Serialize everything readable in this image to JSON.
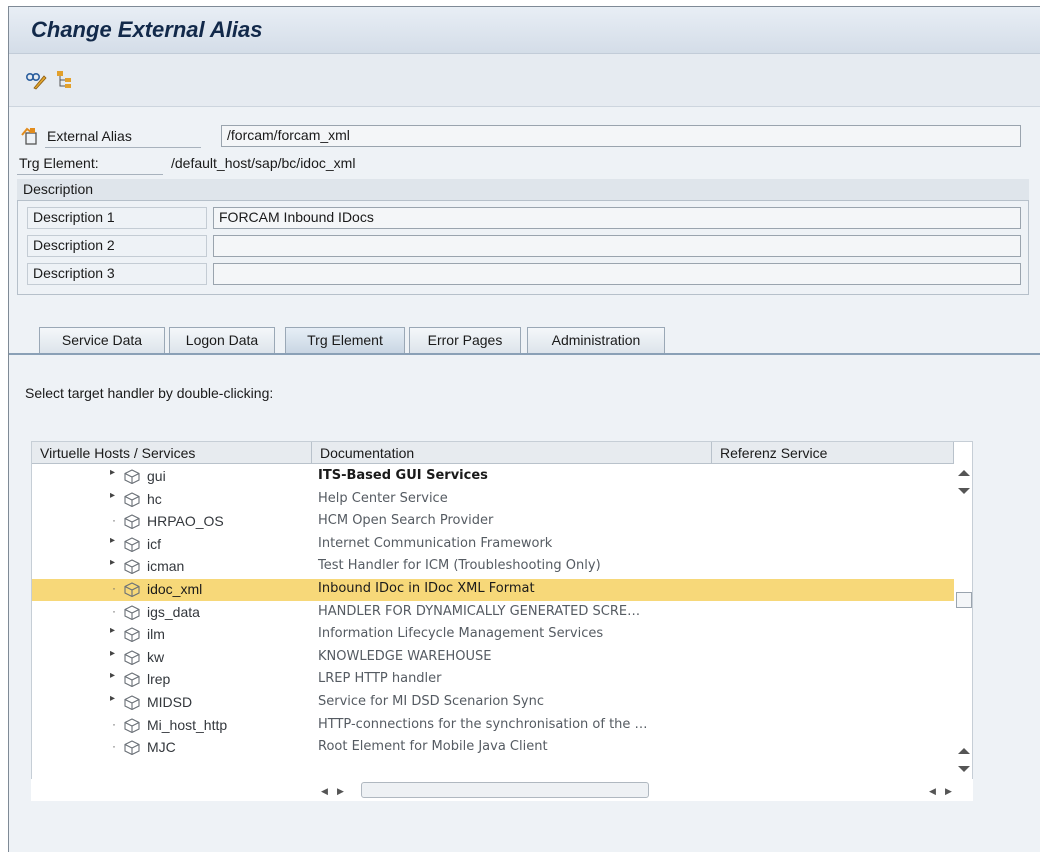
{
  "window": {
    "title": "Change External Alias"
  },
  "toolbar": {
    "icons": [
      "display-change-icon",
      "hierarchy-icon"
    ]
  },
  "header": {
    "external_alias_label": "External Alias",
    "external_alias_value": "/forcam/forcam_xml",
    "trg_element_label": "Trg Element:",
    "trg_element_value": "/default_host/sap/bc/idoc_xml"
  },
  "description": {
    "title": "Description",
    "rows": [
      {
        "label": "Description 1",
        "value": "FORCAM Inbound IDocs"
      },
      {
        "label": "Description 2",
        "value": ""
      },
      {
        "label": "Description 3",
        "value": ""
      }
    ]
  },
  "tabs": [
    {
      "label": "Service Data",
      "active": false
    },
    {
      "label": "Logon Data",
      "active": false
    },
    {
      "label": "Trg Element",
      "active": true
    },
    {
      "label": "Error Pages",
      "active": false
    },
    {
      "label": "Administration",
      "active": false
    }
  ],
  "instruction": "Select target handler by double-clicking:",
  "grid": {
    "columns": [
      "Virtuelle Hosts / Services",
      "Documentation",
      "Referenz Service"
    ],
    "rows": [
      {
        "name": "gui",
        "doc": "ITS-Based GUI Services",
        "expander": "tri",
        "bold": true,
        "selected": false
      },
      {
        "name": "hc",
        "doc": "Help Center Service",
        "expander": "tri",
        "bold": false,
        "selected": false
      },
      {
        "name": "HRPAO_OS",
        "doc": "HCM Open Search Provider",
        "expander": "dot",
        "bold": false,
        "selected": false
      },
      {
        "name": "icf",
        "doc": "Internet Communication Framework",
        "expander": "tri",
        "bold": false,
        "selected": false
      },
      {
        "name": "icman",
        "doc": "Test Handler for ICM (Troubleshooting Only)",
        "expander": "tri",
        "bold": false,
        "selected": false
      },
      {
        "name": "idoc_xml",
        "doc": "Inbound IDoc in IDoc XML Format",
        "expander": "dot",
        "bold": false,
        "selected": true
      },
      {
        "name": "igs_data",
        "doc": "HANDLER FOR DYNAMICALLY GENERATED SCRE…",
        "expander": "dot",
        "bold": false,
        "selected": false
      },
      {
        "name": "ilm",
        "doc": "Information Lifecycle Management Services",
        "expander": "tri",
        "bold": false,
        "selected": false
      },
      {
        "name": "kw",
        "doc": "KNOWLEDGE WAREHOUSE",
        "expander": "tri",
        "bold": false,
        "selected": false
      },
      {
        "name": "lrep",
        "doc": "LREP HTTP handler",
        "expander": "tri",
        "bold": false,
        "selected": false
      },
      {
        "name": "MIDSD",
        "doc": "Service for MI DSD Scenarion Sync",
        "expander": "tri",
        "bold": false,
        "selected": false
      },
      {
        "name": "Mi_host_http",
        "doc": "HTTP-connections  for the synchronisation of the …",
        "expander": "dot",
        "bold": false,
        "selected": false
      },
      {
        "name": "MJC",
        "doc": "Root Element for Mobile Java Client",
        "expander": "dot",
        "bold": false,
        "selected": false
      }
    ]
  },
  "colors": {
    "title": "#12294a",
    "selected_row": "#f7d879",
    "frame_bg": "#eef2f6"
  }
}
